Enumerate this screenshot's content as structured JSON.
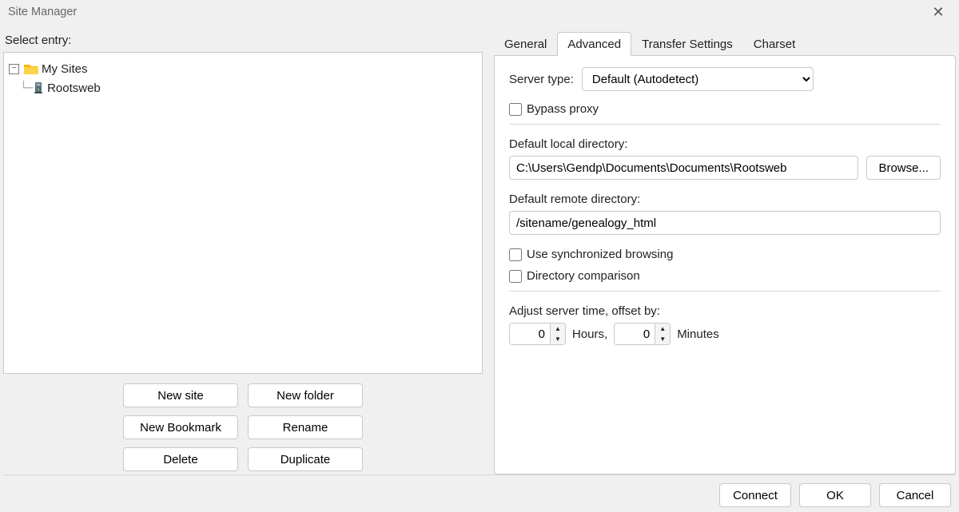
{
  "window": {
    "title": "Site Manager"
  },
  "left": {
    "label": "Select entry:",
    "root_label": "My Sites",
    "site_label": "Rootsweb",
    "buttons": {
      "new_site": "New site",
      "new_folder": "New folder",
      "new_bookmark": "New Bookmark",
      "rename": "Rename",
      "delete": "Delete",
      "duplicate": "Duplicate"
    }
  },
  "tabs": {
    "general": "General",
    "advanced": "Advanced",
    "transfer": "Transfer Settings",
    "charset": "Charset"
  },
  "advanced": {
    "server_type_label": "Server type:",
    "server_type_value": "Default (Autodetect)",
    "bypass_proxy": "Bypass proxy",
    "local_dir_label": "Default local directory:",
    "local_dir_value": "C:\\Users\\Gendp\\Documents\\Documents\\Rootsweb",
    "browse": "Browse...",
    "remote_dir_label": "Default remote directory:",
    "remote_dir_value": "/sitename/genealogy_html",
    "sync_browsing": "Use synchronized browsing",
    "dir_compare": "Directory comparison",
    "offset_label": "Adjust server time, offset by:",
    "hours_value": "0",
    "hours_label": "Hours,",
    "minutes_value": "0",
    "minutes_label": "Minutes"
  },
  "footer": {
    "connect": "Connect",
    "ok": "OK",
    "cancel": "Cancel"
  }
}
